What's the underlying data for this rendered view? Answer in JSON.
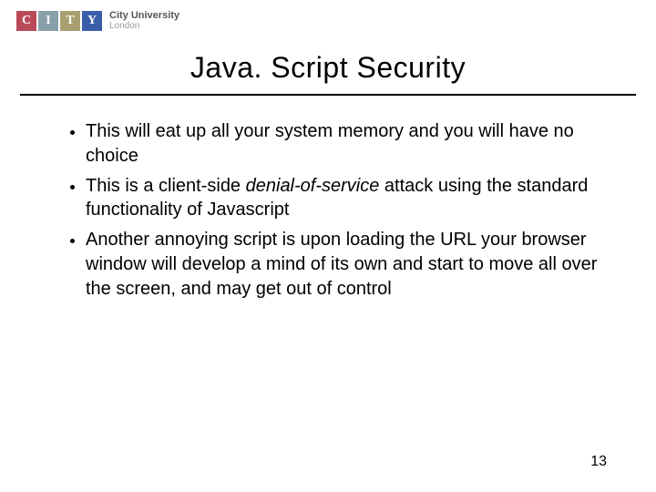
{
  "logo": {
    "letters": [
      "C",
      "I",
      "T",
      "Y"
    ],
    "name": "City University",
    "city": "London"
  },
  "title": "Java. Script  Security",
  "bullets": [
    {
      "pre": "This will eat up all your system memory and you will have no choice",
      "em": "",
      "post": ""
    },
    {
      "pre": "This is a client-side ",
      "em": "denial-of-service",
      "post": " attack using the standard functionality of Javascript"
    },
    {
      "pre": "Another annoying script is upon loading the URL your browser window will develop a mind of its own and start to move all over the screen, and may get out of control",
      "em": "",
      "post": ""
    }
  ],
  "page": "13"
}
